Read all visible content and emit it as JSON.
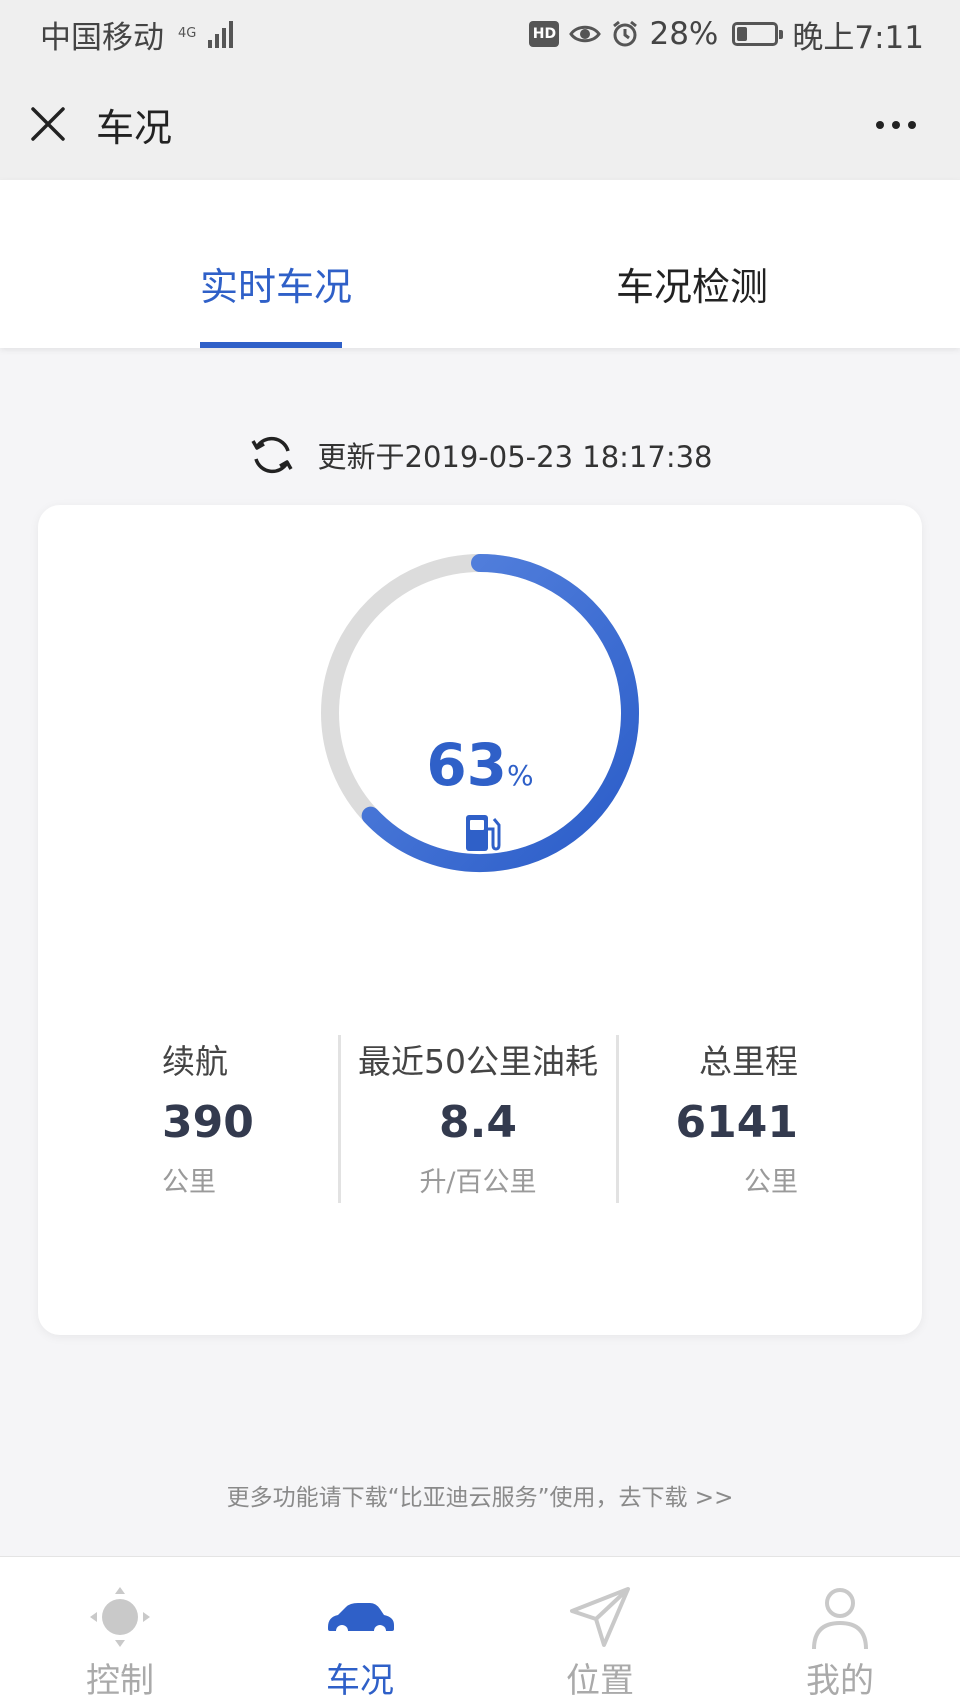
{
  "status_bar": {
    "carrier": "中国移动",
    "network": "4G",
    "hd": "HD",
    "battery": "28%",
    "battery_level": 0.28,
    "time": "晚上7:11"
  },
  "title_bar": {
    "title": "车况"
  },
  "tabs": [
    {
      "label": "实时车况",
      "active": true
    },
    {
      "label": "车况检测",
      "active": false
    }
  ],
  "update": {
    "text": "更新于2019-05-23 18:17:38"
  },
  "gauge": {
    "value": "63",
    "unit": "%",
    "fraction": 0.63,
    "color": "#2f60c8",
    "track_color": "#dcdcdc"
  },
  "stats": [
    {
      "label": "续航",
      "value": "390",
      "unit": "公里"
    },
    {
      "label": "最近50公里油耗",
      "value": "8.4",
      "unit": "升/百公里"
    },
    {
      "label": "总里程",
      "value": "6141",
      "unit": "公里"
    }
  ],
  "footer_note": "更多功能请下载“比亚迪云服务”使用，去下载 >>",
  "nav": [
    {
      "label": "控制",
      "icon": "control-icon",
      "active": false
    },
    {
      "label": "车况",
      "icon": "car-icon",
      "active": true
    },
    {
      "label": "位置",
      "icon": "location-icon",
      "active": false
    },
    {
      "label": "我的",
      "icon": "profile-icon",
      "active": false
    }
  ]
}
